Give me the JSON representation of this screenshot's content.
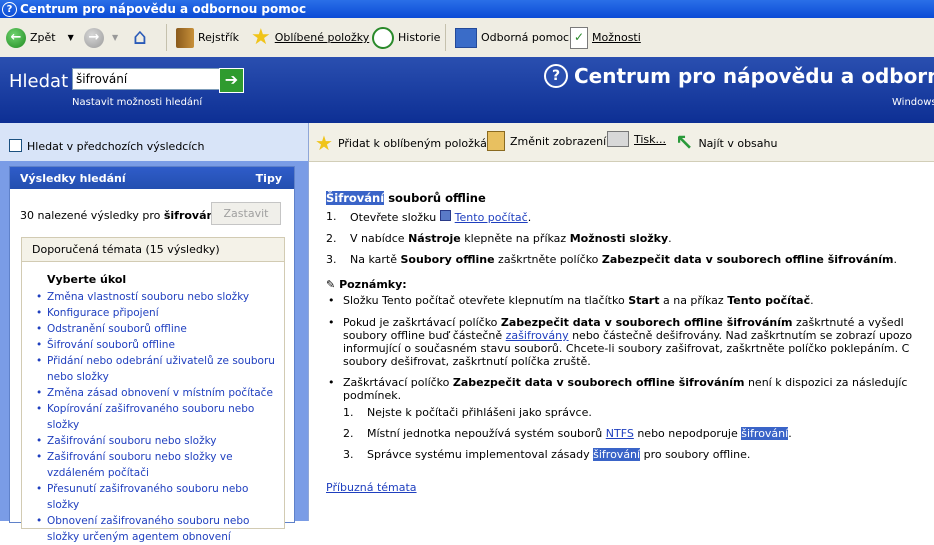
{
  "window": {
    "title": "Centrum pro nápovědu a odbornou pomoc"
  },
  "toolbar": {
    "back": "Zpět",
    "index": "Rejstřík",
    "favorites": "Oblíbené položky",
    "history": "Historie",
    "support": "Odborná pomoc",
    "options": "Možnosti"
  },
  "search": {
    "label": "Hledat",
    "value": "šifrování",
    "options_link": "Nastavit možnosti hledání"
  },
  "header": {
    "title": "Centrum pro nápovědu a odbornou",
    "windows": "Windows"
  },
  "left": {
    "prev_results": "Hledat v předchozích výsledcích",
    "results_title": "Výsledky hledání",
    "tips": "Tipy",
    "count_text": "30 nalezené výsledky pro ",
    "count_term": "šifrování",
    "stop": "Zastavit",
    "suggested": "Doporučená témata (15 výsledky)",
    "task_header": "Vyberte úkol",
    "topics": [
      "Změna vlastností souboru nebo složky",
      "Konfigurace připojení",
      "Odstranění souborů offline",
      "Šifrování souborů offline",
      "Přidání nebo odebrání uživatelů ze souboru nebo složky",
      "Změna zásad obnovení v místním počítače",
      "Kopírování zašifrovaného souboru nebo složky",
      "Zašifrování souboru nebo složky",
      "Zašifrování souboru nebo složky ve vzdáleném počítači",
      "Přesunutí zašifrovaného souboru nebo složky",
      "Obnovení zašifrovaného souboru nebo složky určeným agentem obnovení"
    ]
  },
  "content_toolbar": {
    "add_fav": "Přidat k oblíbeným položkám",
    "change_view": "Změnit zobrazení",
    "print": "Tisk...",
    "locate": "Najít v obsahu"
  },
  "article": {
    "title_hl": "Šifrování",
    "title_rest": " souborů offline",
    "step1_pre": "Otevřete složku ",
    "step1_link": "Tento počítač",
    "step2_a": "V nabídce ",
    "step2_b": "Nástroje",
    "step2_c": " klepněte na příkaz ",
    "step2_d": "Možnosti složky",
    "step3_a": "Na kartě ",
    "step3_b": "Soubory offline",
    "step3_c": " zaškrtněte políčko ",
    "step3_d": "Zabezpečit data v souborech offline šifrováním",
    "notes_title": "Poznámky:",
    "note1_a": "Složku Tento počítač otevřete klepnutím na tlačítko ",
    "note1_b": "Start",
    "note1_c": " a na příkaz ",
    "note1_d": "Tento počítač",
    "note2_l1a": "Pokud je zaškrtávací políčko ",
    "note2_l1b": "Zabezpečit data v souborech offline šifrováním",
    "note2_l1c": " zaškrtnuté a vyšedl",
    "note2_l2a": "soubory offline buď částečně ",
    "note2_l2link": "zašifrovány",
    "note2_l2b": " nebo částečně dešifrovány. Nad zaškrtnutím se zobrazí upozo",
    "note2_l3": "informující o současném stavu souborů. Chcete-li soubory zašifrovat, zaškrtněte políčko poklepáním. C",
    "note2_l4": "soubory dešifrovat, zaškrtnutí políčka zruště.",
    "note3_l1a": "Zaškrtávací políčko ",
    "note3_l1b": "Zabezpečit data v souborech offline šifrováním",
    "note3_l1c": " není k dispozici za následujíc",
    "note3_l2": "podmínek.",
    "sub1": "Nejste k počítači přihlášeni jako správce.",
    "sub2_a": "Místní jednotka nepoužívá systém souborů ",
    "sub2_link": "NTFS",
    "sub2_b": " nebo nepodporuje ",
    "sub2_hl": "šifrování",
    "sub3_a": "Správce systému implementoval zásady ",
    "sub3_hl": "šifrování",
    "sub3_b": " pro soubory offline.",
    "related": "Příbuzná témata"
  }
}
